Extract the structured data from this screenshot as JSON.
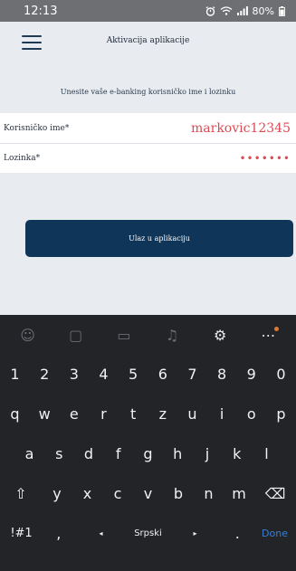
{
  "status_bar": {
    "time": "12:13",
    "battery": "80%"
  },
  "app_bar": {
    "title": "Aktivacija aplikacije"
  },
  "form": {
    "instruction": "Unesite vaše e-banking korisničko ime i lozinku",
    "username_label": "Korisničko ime*",
    "username_value": "markovic12345",
    "password_label": "Lozinka*",
    "password_value": "•••••••"
  },
  "actions": {
    "login_label": "Ulaz u aplikaciju"
  },
  "keyboard": {
    "toolbar": [
      {
        "name": "emoji-icon",
        "glyph": "☺"
      },
      {
        "name": "sticker-icon",
        "glyph": "▢"
      },
      {
        "name": "gif-icon",
        "glyph": "▭"
      },
      {
        "name": "microphone-icon",
        "glyph": "♫"
      },
      {
        "name": "settings-icon",
        "glyph": "⚙"
      },
      {
        "name": "more-icon",
        "glyph": "⋯"
      }
    ],
    "row_numbers": [
      "1",
      "2",
      "3",
      "4",
      "5",
      "6",
      "7",
      "8",
      "9",
      "0"
    ],
    "row_top": [
      "q",
      "w",
      "e",
      "r",
      "t",
      "z",
      "u",
      "i",
      "o",
      "p"
    ],
    "row_mid": [
      "a",
      "s",
      "d",
      "f",
      "g",
      "h",
      "j",
      "k",
      "l"
    ],
    "row_bottom": [
      "y",
      "x",
      "c",
      "v",
      "b",
      "n",
      "m"
    ],
    "shift_glyph": "⇧",
    "backspace_glyph": "⌫",
    "symbols_label": "!#1",
    "comma_label": ",",
    "language_label": "Srpski",
    "left_arrow": "◂",
    "right_arrow": "▸",
    "period_label": ".",
    "done_label": "Done"
  },
  "colors": {
    "accent_red": "#dd4b55",
    "button_navy": "#0f3559",
    "keyboard_bg": "#222428",
    "done_blue": "#3a7fd6"
  }
}
